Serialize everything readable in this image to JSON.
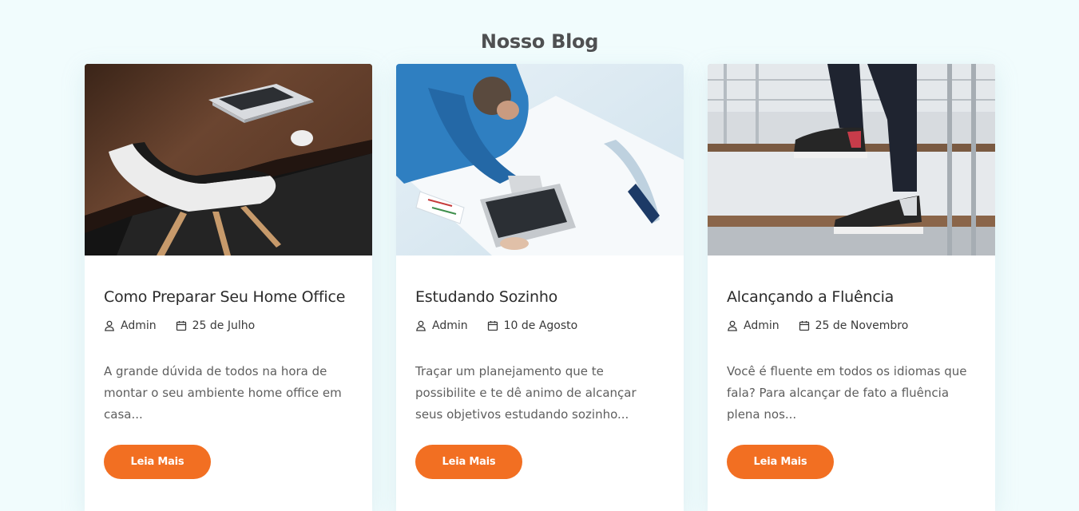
{
  "section": {
    "title": "Nosso Blog"
  },
  "posts": [
    {
      "image_alt": "Mesa de madeira com laptop e cadeira branca",
      "title": "Como Preparar Seu Home Office",
      "author": "Admin",
      "date": "25 de Julho",
      "excerpt": "A grande dúvida de todos na hora de montar o seu ambiente home office em casa...",
      "button_label": "Leia Mais"
    },
    {
      "image_alt": "Homem estudando com laptop em mesa branca",
      "title": "Estudando Sozinho",
      "author": "Admin",
      "date": "10 de Agosto",
      "excerpt": "Traçar um planejamento que te possibilite e te dê animo de alcançar seus objetivos estudando sozinho...",
      "button_label": "Leia Mais"
    },
    {
      "image_alt": "Pessoa subindo escada de madeira",
      "title": "Alcançando a Fluência",
      "author": "Admin",
      "date": "25 de Novembro",
      "excerpt": "Você é fluente em todos os idiomas que fala? Para alcançar de fato a fluência plena nos...",
      "button_label": "Leia Mais"
    }
  ],
  "icons": {
    "author": "user-icon",
    "date": "calendar-icon"
  },
  "colors": {
    "accent": "#f26f22",
    "background": "#f1fcfd",
    "title": "#4f5052"
  }
}
